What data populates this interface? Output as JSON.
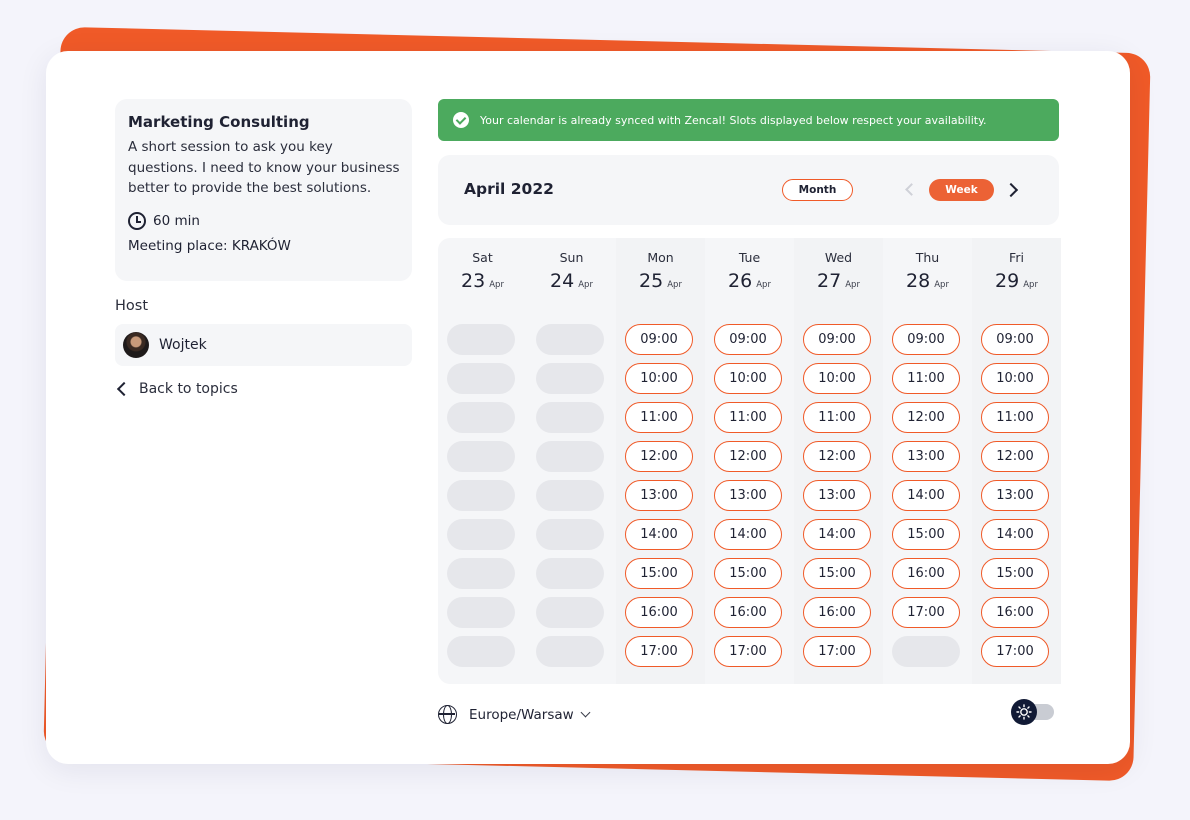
{
  "colors": {
    "accent": "#f05a28",
    "success": "#4caa5e",
    "text": "#1f2233",
    "panel": "#f5f6f8"
  },
  "topic": {
    "title": "Marketing Consulting",
    "description": "A short session to ask you key questions. I need to know your business better to provide the best solutions.",
    "duration": "60 min",
    "place": "Meeting place: KRAKÓW"
  },
  "host": {
    "label": "Host",
    "name": "Wojtek"
  },
  "back_link": "Back to topics",
  "banner": {
    "icon": "check-circle-icon",
    "text": "Your calendar is already synced with Zencal! Slots displayed below respect your availability."
  },
  "calendar": {
    "month_title": "April 2022",
    "month_button": "Month",
    "week_button": "Week",
    "view": "week",
    "days": [
      {
        "name": "Sat",
        "num": "23",
        "mon": "Apr",
        "slots": [
          "",
          "",
          "",
          "",
          "",
          "",
          "",
          "",
          ""
        ]
      },
      {
        "name": "Sun",
        "num": "24",
        "mon": "Apr",
        "slots": [
          "",
          "",
          "",
          "",
          "",
          "",
          "",
          "",
          ""
        ]
      },
      {
        "name": "Mon",
        "num": "25",
        "mon": "Apr",
        "slots": [
          "09:00",
          "10:00",
          "11:00",
          "12:00",
          "13:00",
          "14:00",
          "15:00",
          "16:00",
          "17:00"
        ]
      },
      {
        "name": "Tue",
        "num": "26",
        "mon": "Apr",
        "slots": [
          "09:00",
          "10:00",
          "11:00",
          "12:00",
          "13:00",
          "14:00",
          "15:00",
          "16:00",
          "17:00"
        ]
      },
      {
        "name": "Wed",
        "num": "27",
        "mon": "Apr",
        "slots": [
          "09:00",
          "10:00",
          "11:00",
          "12:00",
          "13:00",
          "14:00",
          "15:00",
          "16:00",
          "17:00"
        ]
      },
      {
        "name": "Thu",
        "num": "28",
        "mon": "Apr",
        "slots": [
          "09:00",
          "11:00",
          "12:00",
          "13:00",
          "14:00",
          "15:00",
          "16:00",
          "17:00",
          ""
        ]
      },
      {
        "name": "Fri",
        "num": "29",
        "mon": "Apr",
        "slots": [
          "09:00",
          "10:00",
          "11:00",
          "12:00",
          "13:00",
          "14:00",
          "15:00",
          "16:00",
          "17:00"
        ]
      }
    ]
  },
  "timezone": "Europe/Warsaw",
  "theme_toggle": {
    "icon": "sun-icon",
    "state": "light"
  }
}
